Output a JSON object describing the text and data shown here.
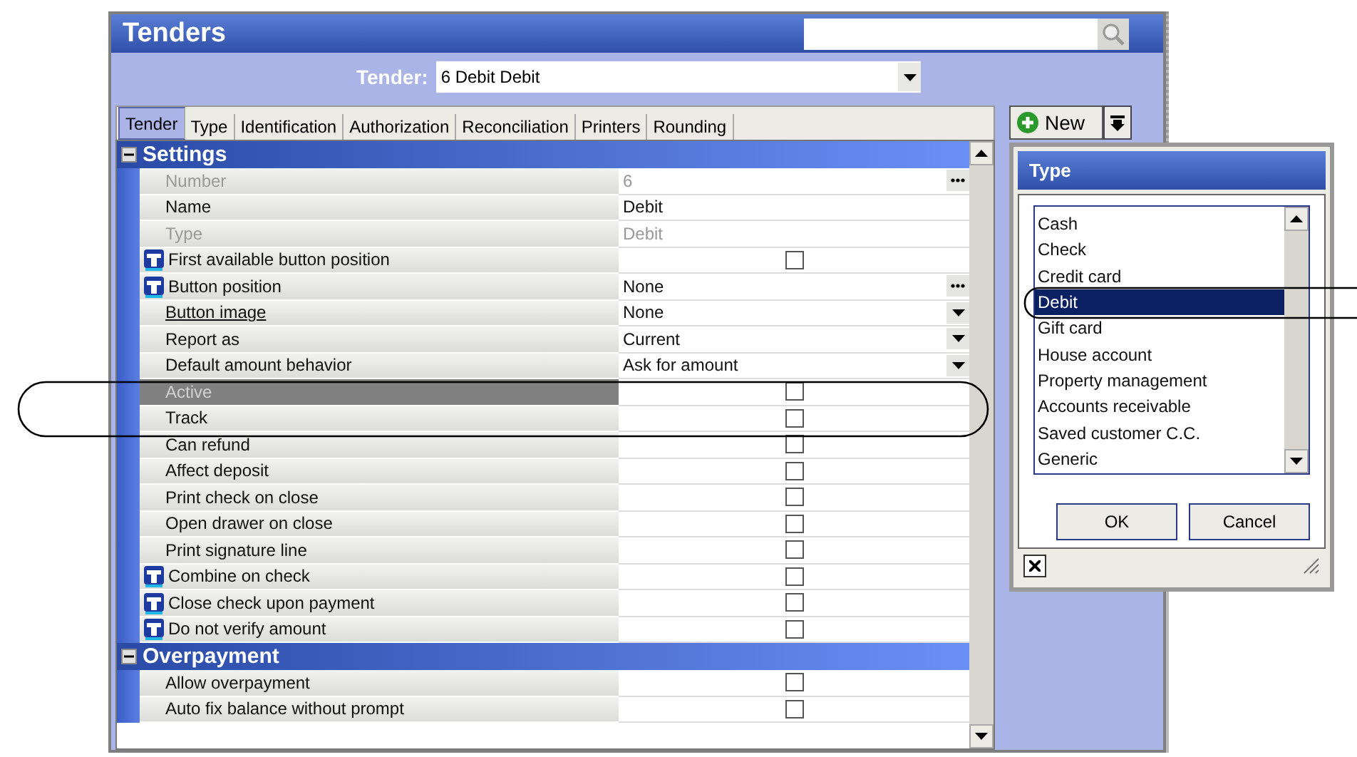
{
  "window": {
    "title": "Tenders"
  },
  "tender_selector": {
    "label": "Tender:",
    "value": "6 Debit Debit"
  },
  "tabs": [
    {
      "label": "Tender",
      "selected": true
    },
    {
      "label": "Type",
      "selected": false
    },
    {
      "label": "Identification",
      "selected": false
    },
    {
      "label": "Authorization",
      "selected": false
    },
    {
      "label": "Reconciliation",
      "selected": false
    },
    {
      "label": "Printers",
      "selected": false
    },
    {
      "label": "Rounding",
      "selected": false
    }
  ],
  "sections": [
    {
      "title": "Settings",
      "expanded": true,
      "rows": [
        {
          "label": "Number",
          "kind": "ellipsis",
          "value": "6",
          "disabled": true,
          "selected": false,
          "marked": false,
          "link": false
        },
        {
          "label": "Name",
          "kind": "text",
          "value": "Debit",
          "disabled": false,
          "selected": false,
          "marked": false,
          "link": false
        },
        {
          "label": "Type",
          "kind": "text",
          "value": "Debit",
          "disabled": true,
          "selected": false,
          "marked": false,
          "link": false
        },
        {
          "label": "First available button position",
          "kind": "checkbox",
          "checked": false,
          "disabled": false,
          "selected": false,
          "marked": true,
          "link": false
        },
        {
          "label": "Button position",
          "kind": "ellipsis",
          "value": "None",
          "disabled": false,
          "selected": false,
          "marked": true,
          "link": false
        },
        {
          "label": "Button image",
          "kind": "dropdown",
          "value": "None",
          "disabled": false,
          "selected": false,
          "marked": false,
          "link": true
        },
        {
          "label": "Report as",
          "kind": "dropdown",
          "value": "Current",
          "disabled": false,
          "selected": false,
          "marked": false,
          "link": false
        },
        {
          "label": "Default amount behavior",
          "kind": "dropdown",
          "value": "Ask for amount",
          "disabled": false,
          "selected": false,
          "marked": false,
          "link": false
        },
        {
          "label": "Active",
          "kind": "checkbox",
          "checked": false,
          "disabled": true,
          "selected": true,
          "marked": false,
          "link": false
        },
        {
          "label": "Track",
          "kind": "checkbox",
          "checked": false,
          "disabled": false,
          "selected": false,
          "marked": false,
          "link": false
        },
        {
          "label": "Can refund",
          "kind": "checkbox",
          "checked": false,
          "disabled": false,
          "selected": false,
          "marked": false,
          "link": false
        },
        {
          "label": "Affect deposit",
          "kind": "checkbox",
          "checked": false,
          "disabled": false,
          "selected": false,
          "marked": false,
          "link": false
        },
        {
          "label": "Print check on close",
          "kind": "checkbox",
          "checked": false,
          "disabled": false,
          "selected": false,
          "marked": false,
          "link": false
        },
        {
          "label": "Open drawer on close",
          "kind": "checkbox",
          "checked": false,
          "disabled": false,
          "selected": false,
          "marked": false,
          "link": false
        },
        {
          "label": "Print signature line",
          "kind": "checkbox",
          "checked": false,
          "disabled": false,
          "selected": false,
          "marked": false,
          "link": false
        },
        {
          "label": "Combine on check",
          "kind": "checkbox",
          "checked": false,
          "disabled": false,
          "selected": false,
          "marked": true,
          "link": false
        },
        {
          "label": "Close check upon payment",
          "kind": "checkbox",
          "checked": false,
          "disabled": false,
          "selected": false,
          "marked": true,
          "link": false
        },
        {
          "label": "Do not verify amount",
          "kind": "checkbox",
          "checked": false,
          "disabled": false,
          "selected": false,
          "marked": true,
          "link": false
        }
      ]
    },
    {
      "title": "Overpayment",
      "expanded": true,
      "rows": [
        {
          "label": "Allow overpayment",
          "kind": "checkbox",
          "checked": false,
          "disabled": false,
          "selected": false,
          "marked": false,
          "link": false
        },
        {
          "label": "Auto fix balance without prompt",
          "kind": "checkbox",
          "checked": false,
          "disabled": false,
          "selected": false,
          "marked": false,
          "link": false
        }
      ]
    }
  ],
  "new_button": {
    "label": "New"
  },
  "type_dialog": {
    "title": "Type",
    "items": [
      {
        "label": "Cash",
        "selected": false
      },
      {
        "label": "Check",
        "selected": false
      },
      {
        "label": "Credit card",
        "selected": false
      },
      {
        "label": "Debit",
        "selected": true
      },
      {
        "label": "Gift card",
        "selected": false
      },
      {
        "label": "House account",
        "selected": false
      },
      {
        "label": "Property management",
        "selected": false
      },
      {
        "label": "Accounts receivable",
        "selected": false
      },
      {
        "label": "Saved customer C.C.",
        "selected": false
      },
      {
        "label": "Generic",
        "selected": false
      }
    ],
    "buttons": [
      "OK",
      "Cancel"
    ]
  }
}
